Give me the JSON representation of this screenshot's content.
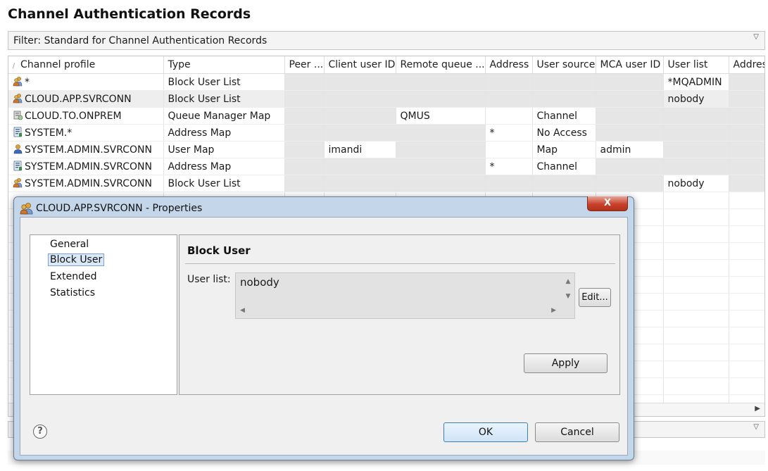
{
  "page_title": "Channel Authentication Records",
  "filter": {
    "label": "Filter:  Standard for Channel Authentication Records"
  },
  "table": {
    "columns": [
      "Channel profile",
      "Type",
      "Peer ...",
      "Client user ID",
      "Remote queue ...",
      "Address",
      "User source",
      "MCA user ID",
      "User list",
      "Addres"
    ],
    "rows": [
      {
        "icon": "user-group-icon",
        "profile": "*",
        "type": "Block User List",
        "peer": "",
        "client": "",
        "remote": "",
        "address": "",
        "source": "",
        "mca": "",
        "userlist": "*MQADMIN",
        "na": [
          2,
          3,
          4,
          5,
          6,
          7,
          9
        ]
      },
      {
        "icon": "user-group-icon",
        "profile": "CLOUD.APP.SVRCONN",
        "type": "Block User List",
        "peer": "",
        "client": "",
        "remote": "",
        "address": "",
        "source": "",
        "mca": "",
        "userlist": "nobody",
        "na": [
          2,
          3,
          4,
          5,
          6,
          7,
          9
        ],
        "selected": true
      },
      {
        "icon": "queue-manager-icon",
        "profile": "CLOUD.TO.ONPREM",
        "type": "Queue Manager Map",
        "peer": "",
        "client": "",
        "remote": "QMUS",
        "address": "",
        "source": "Channel",
        "mca": "",
        "userlist": "",
        "na": [
          2,
          3,
          7,
          8,
          9
        ]
      },
      {
        "icon": "address-map-icon",
        "profile": "SYSTEM.*",
        "type": "Address Map",
        "peer": "",
        "client": "",
        "remote": "",
        "address": "*",
        "source": "No Access",
        "mca": "",
        "userlist": "",
        "na": [
          2,
          3,
          4,
          7,
          8,
          9
        ]
      },
      {
        "icon": "user-map-icon",
        "profile": "SYSTEM.ADMIN.SVRCONN",
        "type": "User Map",
        "peer": "",
        "client": "imandi",
        "remote": "",
        "address": "",
        "source": "Map",
        "mca": "admin",
        "userlist": "",
        "na": [
          2,
          4,
          8,
          9
        ]
      },
      {
        "icon": "address-map-icon",
        "profile": "SYSTEM.ADMIN.SVRCONN",
        "type": "Address Map",
        "peer": "",
        "client": "",
        "remote": "",
        "address": "*",
        "source": "Channel",
        "mca": "",
        "userlist": "",
        "na": [
          2,
          3,
          4,
          7,
          8,
          9
        ]
      },
      {
        "icon": "user-group-icon",
        "profile": "SYSTEM.ADMIN.SVRCONN",
        "type": "Block User List",
        "peer": "",
        "client": "",
        "remote": "",
        "address": "",
        "source": "",
        "mca": "",
        "userlist": "nobody",
        "na": [
          2,
          3,
          4,
          5,
          6,
          7,
          9
        ]
      }
    ]
  },
  "dialog": {
    "title": "CLOUD.APP.SVRCONN - Properties",
    "close_label": "X",
    "nav": [
      "General",
      "Block User",
      "Extended",
      "Statistics"
    ],
    "nav_selected": 1,
    "page_heading": "Block User",
    "user_list_label": "User list:",
    "user_list_value": "nobody",
    "edit_label": "Edit...",
    "apply_label": "Apply",
    "ok_label": "OK",
    "cancel_label": "Cancel",
    "help_label": "?"
  }
}
